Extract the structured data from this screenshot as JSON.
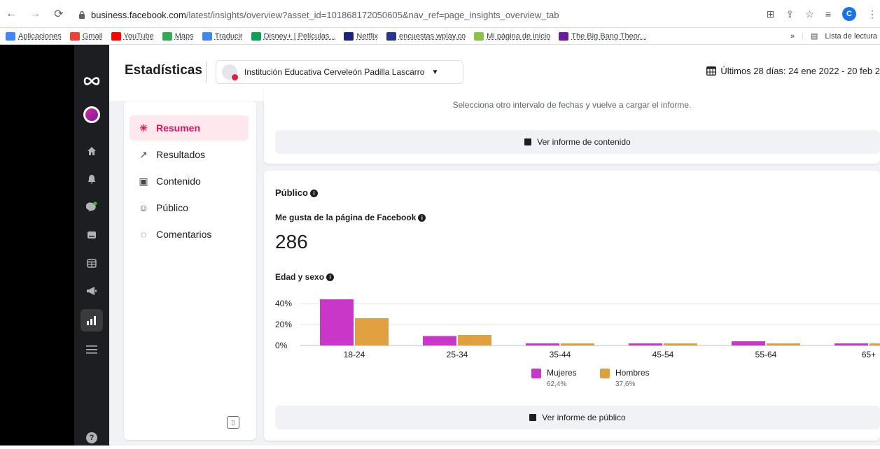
{
  "browser": {
    "url_domain": "business.facebook.com",
    "url_path": "/latest/insights/overview?asset_id=101868172050605&nav_ref=page_insights_overview_tab",
    "profile_initial": "C",
    "bookmarks": [
      {
        "label": "Aplicaciones",
        "color": "#4285f4"
      },
      {
        "label": "Gmail",
        "color": "#ea4335"
      },
      {
        "label": "YouTube",
        "color": "#ff0000"
      },
      {
        "label": "Maps",
        "color": "#34a853"
      },
      {
        "label": "Traducir",
        "color": "#4285f4"
      },
      {
        "label": "Disney+ | Películas...",
        "color": "#0f9d58"
      },
      {
        "label": "Netflix",
        "color": "#1a237e"
      },
      {
        "label": "encuestas.wplay.co",
        "color": "#283593"
      },
      {
        "label": "Mi página de inicio",
        "color": "#8bc34a"
      },
      {
        "label": "The Big Bang Theor...",
        "color": "#6a1b9a"
      }
    ],
    "bookmarks_more": "»",
    "reading_list": "Lista de lectura"
  },
  "header": {
    "title": "Estadísticas",
    "page_name": "Institución Educativa Cerveleón Padilla Lascarro",
    "date_range": "Últimos 28 días: 24 ene 2022 - 20 feb 2"
  },
  "sidebar": {
    "items": [
      {
        "label": "Resumen",
        "icon": "sparkle-icon"
      },
      {
        "label": "Resultados",
        "icon": "trend-icon"
      },
      {
        "label": "Contenido",
        "icon": "content-icon"
      },
      {
        "label": "Público",
        "icon": "people-icon"
      },
      {
        "label": "Comentarios",
        "icon": "comment-icon"
      }
    ]
  },
  "content_card": {
    "message": "Selecciona otro intervalo de fechas y vuelve a cargar el informe.",
    "button": "Ver informe de contenido"
  },
  "audience": {
    "title": "Público",
    "likes_label": "Me gusta de la página de Facebook",
    "likes_value": "286",
    "age_sex_label": "Edad y sexo",
    "button": "Ver informe de público",
    "legend": [
      {
        "label": "Mujeres",
        "pct": "62,4%"
      },
      {
        "label": "Hombres",
        "pct": "37,6%"
      }
    ]
  },
  "chart_data": {
    "type": "bar",
    "categories": [
      "18-24",
      "25-34",
      "35-44",
      "45-54",
      "55-64",
      "65+"
    ],
    "series": [
      {
        "name": "Mujeres",
        "color": "#c837c8",
        "values": [
          44,
          9,
          2,
          2,
          4,
          2
        ]
      },
      {
        "name": "Hombres",
        "color": "#e0a040",
        "values": [
          26,
          10,
          2,
          2,
          2,
          2
        ]
      }
    ],
    "ylim": [
      0,
      40
    ],
    "yticks": [
      "0%",
      "20%",
      "40%"
    ],
    "grid": true,
    "legend": "bottom"
  }
}
